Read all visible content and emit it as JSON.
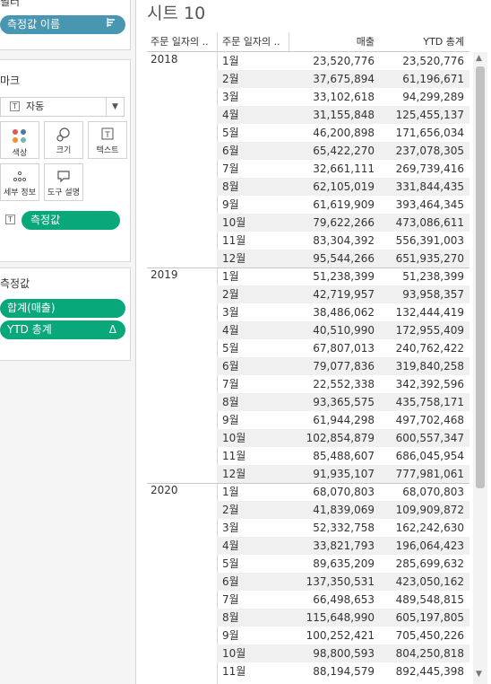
{
  "left": {
    "filters_title": "필터",
    "measure_names_pill": "측정값 이름",
    "measure_names_icon": "sort-icon",
    "marks_title": "마크",
    "mark_type": "자동",
    "mark_buttons": [
      {
        "label": "색상",
        "icon": "color-icon"
      },
      {
        "label": "크기",
        "icon": "size-icon"
      },
      {
        "label": "텍스트",
        "icon": "text-icon"
      },
      {
        "label": "세부 정보",
        "icon": "detail-icon"
      },
      {
        "label": "도구 설명",
        "icon": "tooltip-icon"
      }
    ],
    "text_pill": "측정값",
    "measures_title": "측정값",
    "measures": [
      {
        "label": "합계(매출)",
        "badge": ""
      },
      {
        "label": "YTD 총계",
        "badge": "Δ"
      }
    ]
  },
  "sheet": {
    "title": "시트 10",
    "headers": [
      "주문 일자의 ..",
      "주문 일자의 ..",
      "매출",
      "YTD 총계"
    ],
    "years": [
      {
        "year": "2018",
        "rows": [
          [
            "1월",
            "23,520,776",
            "23,520,776"
          ],
          [
            "2월",
            "37,675,894",
            "61,196,671"
          ],
          [
            "3월",
            "33,102,618",
            "94,299,289"
          ],
          [
            "4월",
            "31,155,848",
            "125,455,137"
          ],
          [
            "5월",
            "46,200,898",
            "171,656,034"
          ],
          [
            "6월",
            "65,422,270",
            "237,078,305"
          ],
          [
            "7월",
            "32,661,111",
            "269,739,416"
          ],
          [
            "8월",
            "62,105,019",
            "331,844,435"
          ],
          [
            "9월",
            "61,619,909",
            "393,464,345"
          ],
          [
            "10월",
            "79,622,266",
            "473,086,611"
          ],
          [
            "11월",
            "83,304,392",
            "556,391,003"
          ],
          [
            "12월",
            "95,544,266",
            "651,935,270"
          ]
        ]
      },
      {
        "year": "2019",
        "rows": [
          [
            "1월",
            "51,238,399",
            "51,238,399"
          ],
          [
            "2월",
            "42,719,957",
            "93,958,357"
          ],
          [
            "3월",
            "38,486,062",
            "132,444,419"
          ],
          [
            "4월",
            "40,510,990",
            "172,955,409"
          ],
          [
            "5월",
            "67,807,013",
            "240,762,422"
          ],
          [
            "6월",
            "79,077,836",
            "319,840,258"
          ],
          [
            "7월",
            "22,552,338",
            "342,392,596"
          ],
          [
            "8월",
            "93,365,575",
            "435,758,171"
          ],
          [
            "9월",
            "61,944,298",
            "497,702,468"
          ],
          [
            "10월",
            "102,854,879",
            "600,557,347"
          ],
          [
            "11월",
            "85,488,607",
            "686,045,954"
          ],
          [
            "12월",
            "91,935,107",
            "777,981,061"
          ]
        ]
      },
      {
        "year": "2020",
        "rows": [
          [
            "1월",
            "68,070,803",
            "68,070,803"
          ],
          [
            "2월",
            "41,839,069",
            "109,909,872"
          ],
          [
            "3월",
            "52,332,758",
            "162,242,630"
          ],
          [
            "4월",
            "33,821,793",
            "196,064,423"
          ],
          [
            "5월",
            "89,635,209",
            "285,699,632"
          ],
          [
            "6월",
            "137,350,531",
            "423,050,162"
          ],
          [
            "7월",
            "66,498,653",
            "489,548,815"
          ],
          [
            "8월",
            "115,648,990",
            "605,197,805"
          ],
          [
            "9월",
            "100,252,421",
            "705,450,226"
          ],
          [
            "10월",
            "98,800,593",
            "804,250,818"
          ],
          [
            "11월",
            "88,194,579",
            "892,445,398"
          ]
        ]
      }
    ]
  }
}
